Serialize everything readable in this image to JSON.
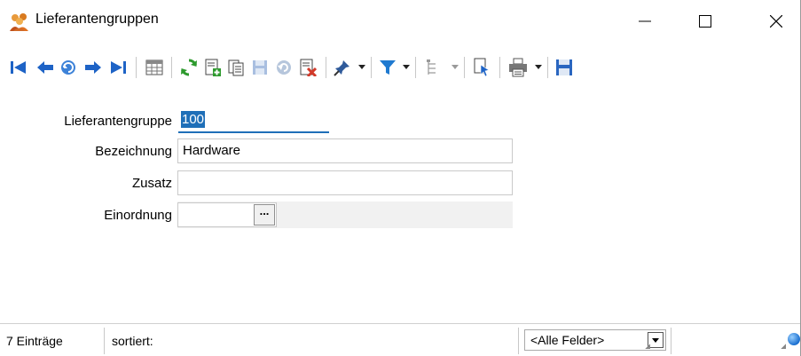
{
  "window": {
    "title": "Lieferantengruppen"
  },
  "toolbar": {
    "buttons": [
      {
        "name": "first-record",
        "icon": "first-record-icon"
      },
      {
        "name": "previous-record",
        "icon": "previous-record-icon"
      },
      {
        "name": "search-record",
        "icon": "search-record-icon"
      },
      {
        "name": "next-record",
        "icon": "next-record-icon"
      },
      {
        "name": "last-record",
        "icon": "last-record-icon"
      },
      {
        "name": "table-view",
        "icon": "table-view-icon"
      },
      {
        "name": "refresh",
        "icon": "refresh-icon"
      },
      {
        "name": "new-record",
        "icon": "new-record-icon"
      },
      {
        "name": "copy-record",
        "icon": "copy-record-icon"
      },
      {
        "name": "save",
        "icon": "save-icon"
      },
      {
        "name": "undo",
        "icon": "undo-icon"
      },
      {
        "name": "delete",
        "icon": "delete-icon"
      },
      {
        "name": "pin",
        "icon": "pin-icon"
      },
      {
        "name": "filter",
        "icon": "filter-icon"
      },
      {
        "name": "tree",
        "icon": "tree-icon"
      },
      {
        "name": "document",
        "icon": "document-icon"
      },
      {
        "name": "print",
        "icon": "print-icon"
      },
      {
        "name": "export",
        "icon": "export-icon"
      }
    ]
  },
  "form": {
    "lieferantengruppe": {
      "label": "Lieferantengruppe",
      "value": "100"
    },
    "bezeichnung": {
      "label": "Bezeichnung",
      "value": "Hardware"
    },
    "zusatz": {
      "label": "Zusatz",
      "value": ""
    },
    "einordnung": {
      "label": "Einordnung",
      "value": "",
      "button_label": "..."
    }
  },
  "statusbar": {
    "count": "7 Einträge",
    "sort": "sortiert:",
    "field_filter": "<Alle Felder>"
  },
  "colors": {
    "accent": "#1f6fb8",
    "nav_blue": "#1e63c6",
    "refresh_green": "#2e9a2e",
    "delete_red": "#d23a2a"
  }
}
